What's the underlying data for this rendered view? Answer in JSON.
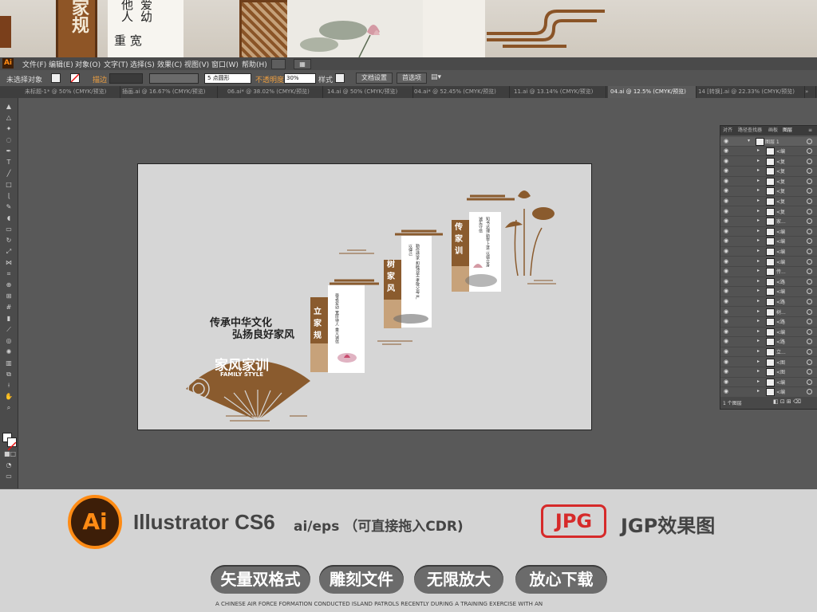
{
  "photo_strip": {
    "banner_chars": "家规",
    "poem_col1": "他人",
    "poem_col2": "爱幼",
    "poem_col3": "重  宽"
  },
  "app": {
    "logo": "Ai",
    "menu": [
      "文件(F)",
      "编辑(E)",
      "对象(O)",
      "文字(T)",
      "选择(S)",
      "效果(C)",
      "视图(V)",
      "窗口(W)",
      "帮助(H)"
    ]
  },
  "control_bar": {
    "selection_label": "未选择对象",
    "stroke_label": "描边",
    "brush_value": "5 点圆形",
    "opacity_label": "不透明度",
    "opacity_value": "30%",
    "style_label": "样式",
    "doc_setup_button": "文档设置",
    "preferences_button": "首选项"
  },
  "document_tabs": [
    "未标题-1* @ 50% (CMYK/预览)",
    "插画.ai @ 16.67% (CMYK/预览)",
    "06.ai* @ 38.02% (CMYK/预览)",
    "14.ai @ 50% (CMYK/预览)",
    "04.ai* @ 52.45% (CMYK/预览)",
    "11.ai @ 13.14% (CMYK/预览)",
    "04.ai @ 12.5% (CMYK/预览)",
    "14 [转换].ai @ 22.33% (CMYK/预览)"
  ],
  "active_tab_index": 6,
  "artwork": {
    "slogan_line1": "传承中华文化",
    "slogan_line2": "弘扬良好家风",
    "fan_title": "家风家训",
    "fan_subtitle": "FAMILY STYLE",
    "panel1_title": "立家规",
    "panel2_title": "树家风",
    "panel3_title": "传家训",
    "panel1_text": "尊老爱幼 宽厚待人 重义诚信",
    "panel2_text": "勤俭持家 和睦邻里 孝敬父母 严以律己",
    "panel3_text": "知书达理 勤学上进 以德立身 诚实守信"
  },
  "layers_panel": {
    "tabs": [
      "对齐",
      "路径查找器",
      "画板",
      "图层"
    ],
    "top_layer": "图层 1",
    "rows": [
      "<编",
      "<复",
      "<复",
      "<复",
      "<复",
      "<复",
      "<复",
      "家...",
      "<编",
      "<编",
      "<编",
      "<编",
      "传...",
      "<路",
      "<编",
      "<路",
      "树...",
      "<路",
      "<编",
      "<路",
      "立...",
      "<图",
      "<图",
      "<编",
      "<编"
    ],
    "footer": "1 个图层"
  },
  "promo": {
    "ai_badge": "Ai",
    "product": "Illustrator CS6",
    "formats": "ai/eps （可直接拖入CDR)",
    "jpg_badge": "JPG",
    "jpg_label": "JGP效果图",
    "pills": [
      "矢量双格式",
      "雕刻文件",
      "无限放大",
      "放心下载"
    ],
    "caption": "A CHINESE AIR FORCE FORMATION CONDUCTED ISLAND PATROLS RECENTLY DURING A TRAINING EXERCISE WITH AN"
  },
  "colors": {
    "brown": "#8a5b2e",
    "ai_orange": "#ff8b14",
    "ai_dark": "#3d1e08",
    "jpg_red": "#d62a2a"
  }
}
